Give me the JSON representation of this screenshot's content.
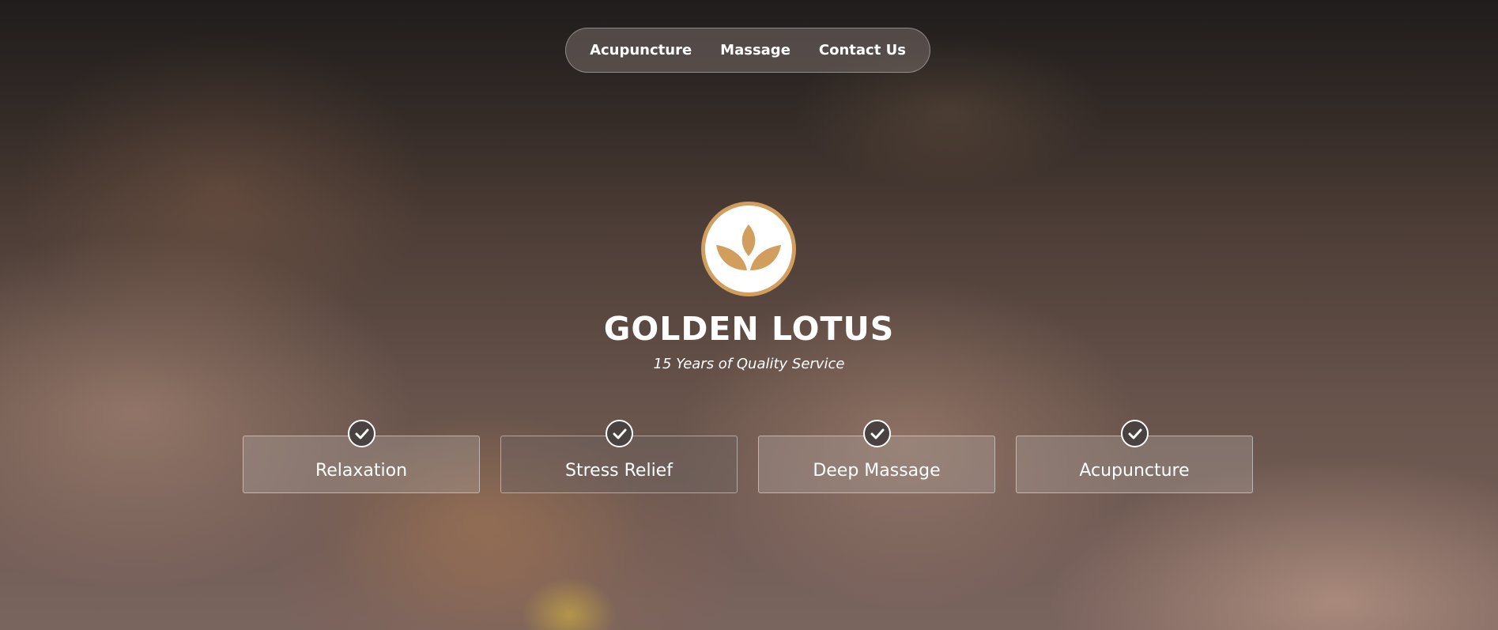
{
  "nav": {
    "items": [
      {
        "label": "Acupuncture"
      },
      {
        "label": "Massage"
      },
      {
        "label": "Contact Us"
      }
    ]
  },
  "brand": {
    "logo_icon": "lotus-icon",
    "title": "GOLDEN LOTUS",
    "tagline": "15 Years of Quality Service"
  },
  "features": [
    {
      "label": "Relaxation",
      "icon": "check-circle-icon"
    },
    {
      "label": "Stress Relief",
      "icon": "check-circle-icon"
    },
    {
      "label": "Deep Massage",
      "icon": "check-circle-icon"
    },
    {
      "label": "Acupuncture",
      "icon": "check-circle-icon"
    }
  ],
  "colors": {
    "accent": "#d19e5e",
    "text": "#ffffff"
  }
}
